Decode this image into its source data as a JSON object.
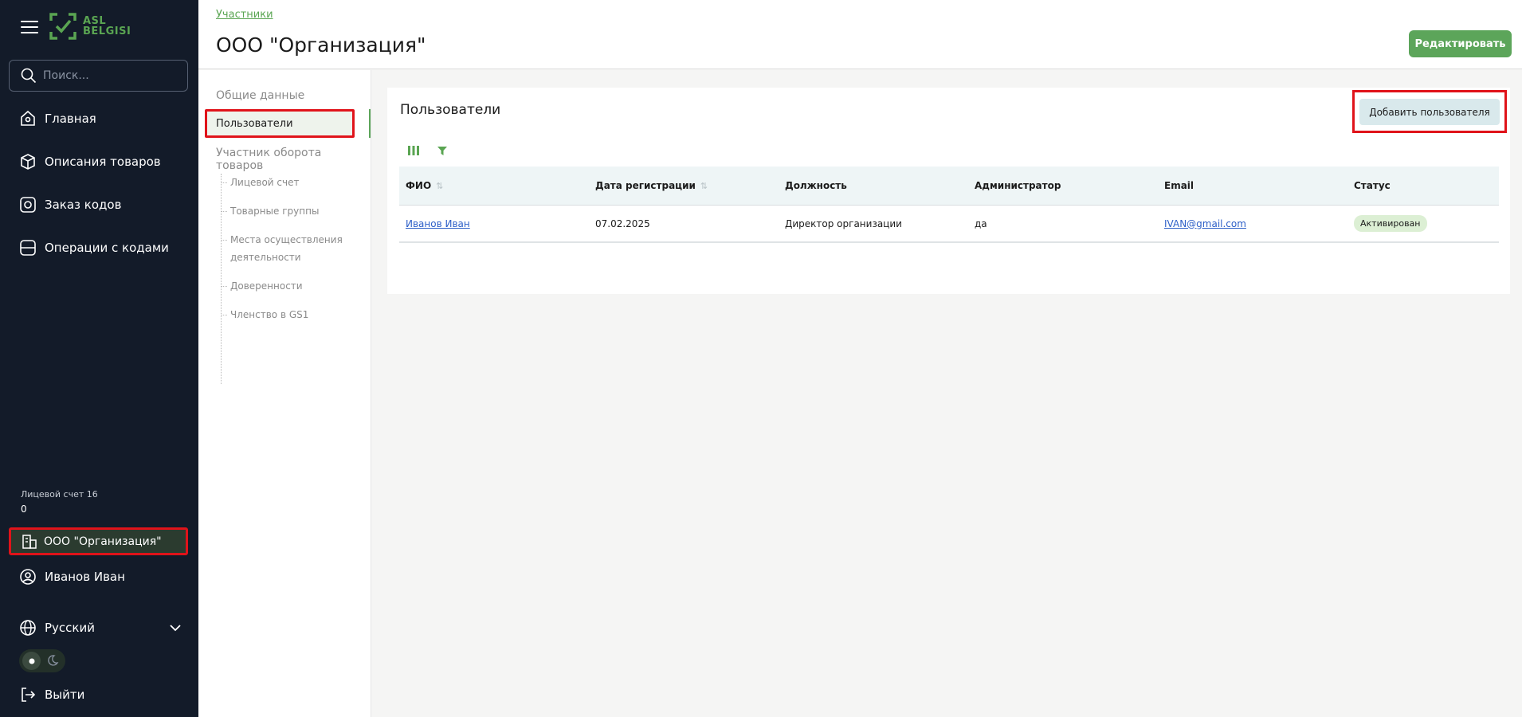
{
  "app": {
    "logo_line1": "ASL",
    "logo_line2": "BELGISI",
    "brand_color": "#5aa552",
    "alert_color": "#e0131a"
  },
  "sidebar": {
    "search_placeholder": "Поиск...",
    "items": [
      {
        "label": "Главная",
        "icon": "home-icon"
      },
      {
        "label": "Описания товаров",
        "icon": "box-icon"
      },
      {
        "label": "Заказ кодов",
        "icon": "scan-icon"
      },
      {
        "label": "Операции с кодами",
        "icon": "operations-icon"
      }
    ],
    "account_label": "Лицевой счет 16",
    "account_value": "0",
    "org_label": "ООО \"Организация\"",
    "user_label": "Иванов Иван",
    "language_label": "Русский",
    "logout_label": "Выйти"
  },
  "header": {
    "breadcrumb": "Участники",
    "title": "ООО \"Организация\"",
    "edit_label": "Редактировать"
  },
  "submenu": {
    "general": "Общие данные",
    "users": "Пользователи",
    "participant": "Участник оборота товаров",
    "sub": [
      "Лицевой счет",
      "Товарные группы",
      "Места осуществления",
      "деятельности",
      "Доверенности",
      "Членство в GS1"
    ]
  },
  "users_panel": {
    "title": "Пользователи",
    "add_label": "Добавить пользователя",
    "columns": [
      "ФИО",
      "Дата регистрации",
      "Должность",
      "Администратор",
      "Email",
      "Статус"
    ],
    "rows": [
      {
        "name": "Иванов Иван",
        "date": "07.02.2025",
        "position": "Директор организации",
        "admin": "да",
        "email": "IVAN@gmail.com",
        "status": "Активирован"
      }
    ]
  }
}
